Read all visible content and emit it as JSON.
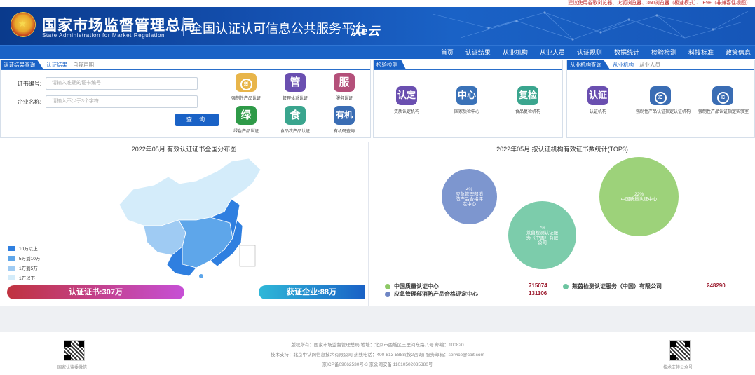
{
  "top_notice": "建议使用谷歌浏览器、火狐浏览器、360浏览器（极速模式）、IE9+（非兼容性视图）",
  "header": {
    "org_cn": "国家市场监督管理总局",
    "org_en": "State Administration  for  Market Regulation",
    "platform": "全国认证认可信息公共服务平台",
    "mark": "认e云"
  },
  "nav": [
    "首页",
    "认证结果",
    "从业机构",
    "从业人员",
    "认证规则",
    "数据统计",
    "检验检测",
    "科技标准",
    "政策信息"
  ],
  "cert_panel": {
    "tabs": [
      "认证结果查询",
      "认证结果",
      "自我声明"
    ],
    "cert_no_label": "证书编号:",
    "cert_no_placeholder": "请输入准确的证书编号",
    "company_label": "企业名称:",
    "company_placeholder": "请输入不少于3个字符",
    "query_button": "查 询",
    "icons": [
      {
        "glyph": "CCC",
        "label": "强制性产品认证",
        "color": "#e8b54a"
      },
      {
        "glyph": "管",
        "label": "管理体系认证",
        "color": "#6a4fb0"
      },
      {
        "glyph": "服",
        "label": "服务认证",
        "color": "#b4507a"
      },
      {
        "glyph": "绿",
        "label": "绿色产品认证",
        "color": "#2e9a48"
      },
      {
        "glyph": "食",
        "label": "食品农产品认证",
        "color": "#3aa58e"
      },
      {
        "glyph": "有机",
        "label": "有机码查询",
        "color": "#3a6db4"
      }
    ]
  },
  "lab_panel": {
    "tabs": [
      "检验检测"
    ],
    "icons": [
      {
        "glyph": "认定",
        "label": "资质认定机构",
        "color": "#6a4fb0"
      },
      {
        "glyph": "中心",
        "label": "国家质检中心",
        "color": "#3a72b8"
      },
      {
        "glyph": "复检",
        "label": "食品复检机构",
        "color": "#3aa58e"
      }
    ]
  },
  "org_panel": {
    "tabs": [
      "从业机构查询",
      "从业机构",
      "从业人员"
    ],
    "icons": [
      {
        "glyph": "认证",
        "label": "认证机构",
        "color": "#6a4fb0"
      },
      {
        "glyph": "CCC",
        "label": "强制性产品认证指定认证机构",
        "color": "#3a6db4"
      },
      {
        "glyph": "CCC",
        "label": "强制性产品认证指定实验室",
        "color": "#3a6db4"
      }
    ]
  },
  "map_section": {
    "title": "2022年05月  有效认证证书全国分布图",
    "legend": [
      {
        "label": "10万以上",
        "color": "#2f7fe0"
      },
      {
        "label": "5万到10万",
        "color": "#5ea6ea"
      },
      {
        "label": "1万到5万",
        "color": "#9fcbf3"
      },
      {
        "label": "1万以下",
        "color": "#d4ecfa"
      }
    ],
    "cert_total": "认证证书:307万",
    "company_total": "获证企业:88万"
  },
  "stats_section": {
    "title": "2022年05月   按认证机构有效证书数统计(TOP3)",
    "bubbles": [
      {
        "pct": "4%",
        "name": "应急管理部消防产品合格评定中心",
        "color": "#7d96cf"
      },
      {
        "pct": "7%",
        "name": "莱茵检测认证服务（中国）有限公司",
        "color": "#7cccab"
      },
      {
        "pct": "22%",
        "name": "中国质量认证中心",
        "color": "#9dd27a"
      }
    ],
    "rows": [
      {
        "name": "中国质量认证中心",
        "value": "715074",
        "color": "#8dc866"
      },
      {
        "name": "莱茵检测认证服务（中国）有限公司",
        "value": "248290",
        "color": "#6cc4a0"
      },
      {
        "name": "应急管理部消防产品合格评定中心",
        "value": "131106",
        "color": "#6f86c4"
      }
    ]
  },
  "footer": {
    "line1": "版权所有：国家市场监督管理总局    地址：北京市西城区三里河东路八号    邮编：100820",
    "line2": "技术支持：北京中认网信息技术有限公司    热线电话：400-813-5888(按2咨询)    服务邮箱：service@cait.com",
    "line3": "京ICP备09062530号-3    京公网安备  11010502035380号",
    "qr_left": "国家认监委微信",
    "qr_right": "技术支持公众号"
  }
}
